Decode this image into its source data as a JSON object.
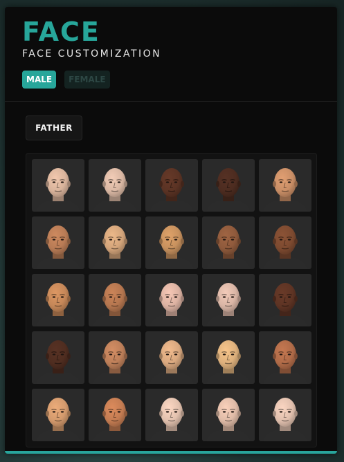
{
  "header": {
    "title": "FACE",
    "subtitle": "FACE CUSTOMIZATION"
  },
  "gender_tabs": {
    "male_label": "MALE",
    "female_label": "FEMALE",
    "selected": "MALE"
  },
  "parent_tab": {
    "label": "FATHER"
  },
  "colors": {
    "accent": "#27a69a",
    "panel": "#0b0b0b",
    "cell": "#2a2a2a",
    "shirt": "#2b2b2b"
  },
  "faces": [
    {
      "id": 1,
      "skin": "#d8b39b"
    },
    {
      "id": 2,
      "skin": "#d9b7a3"
    },
    {
      "id": 3,
      "skin": "#5b3324"
    },
    {
      "id": 4,
      "skin": "#4d2c20"
    },
    {
      "id": 5,
      "skin": "#c98e66"
    },
    {
      "id": 6,
      "skin": "#b87b55"
    },
    {
      "id": 7,
      "skin": "#d3a47a"
    },
    {
      "id": 8,
      "skin": "#c7915e"
    },
    {
      "id": 9,
      "skin": "#8f5a3c"
    },
    {
      "id": 10,
      "skin": "#7d4a30"
    },
    {
      "id": 11,
      "skin": "#c58758"
    },
    {
      "id": 12,
      "skin": "#b5764f"
    },
    {
      "id": 13,
      "skin": "#dcb2a2"
    },
    {
      "id": 14,
      "skin": "#d9b5a5"
    },
    {
      "id": 15,
      "skin": "#5e3424"
    },
    {
      "id": 16,
      "skin": "#4f2d20"
    },
    {
      "id": 17,
      "skin": "#bd7f59"
    },
    {
      "id": 18,
      "skin": "#d9a87f"
    },
    {
      "id": 19,
      "skin": "#ddb07c"
    },
    {
      "id": 20,
      "skin": "#b06b48"
    },
    {
      "id": 21,
      "skin": "#d39a6d"
    },
    {
      "id": 22,
      "skin": "#c47c52"
    },
    {
      "id": 23,
      "skin": "#e2c1ae"
    },
    {
      "id": 24,
      "skin": "#dfbba7"
    },
    {
      "id": 25,
      "skin": "#e0bfad"
    }
  ]
}
